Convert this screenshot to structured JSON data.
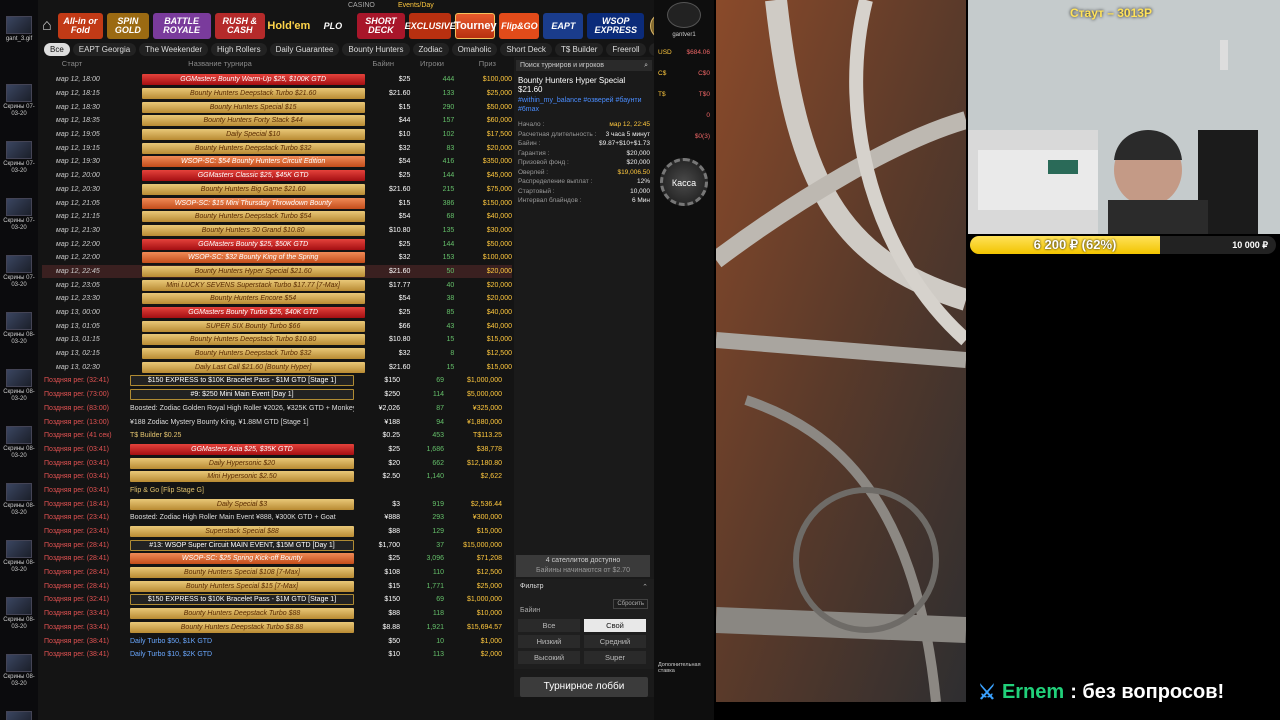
{
  "desktop": {
    "top_label": "gant_3.gif",
    "items": [
      "Скрины 07-03-20",
      "Скрины 07-03-20",
      "Скрины 07-03-20",
      "Скрины 07-03-20",
      "Скрины 08-03-20",
      "Скрины 08-03-20",
      "Скрины 08-03-20",
      "Скрины 08-03-20",
      "Скрины 08-03-20",
      "Скрины 08-03-20",
      "Скрины 08-03-20",
      "Скрины 08-03-20"
    ]
  },
  "nav": {
    "events_label": "Events/Day",
    "casino_label": "CASINO",
    "games": [
      "All-in or Fold",
      "SPIN GOLD",
      "BATTLE ROYALE",
      "RUSH & CASH",
      "Hold'em",
      "PLO",
      "SHORT DECK",
      "EXCLUSIVE",
      "Tourney",
      "Flip&GO",
      "EAPT",
      "WSOP EXPRESS"
    ]
  },
  "tabs": [
    "Все",
    "EAPT Georgia",
    "The Weekender",
    "High Rollers",
    "Daily Guarantee",
    "Bounty Hunters",
    "Zodiac",
    "Omaholic",
    "Short Deck",
    "T$ Builder",
    "Freeroll"
  ],
  "table_header": {
    "start": "Старт",
    "name": "Название турнира",
    "buyin": "Байин",
    "players": "Игроки",
    "prize": "Приз"
  },
  "rows": [
    {
      "start": "мар 12, 18:00",
      "name": "GGMasters Bounty Warm-Up $25, $100K GTD",
      "style": "red",
      "buyin": "$25",
      "players": "444",
      "prize": "$100,000"
    },
    {
      "start": "мар 12, 18:15",
      "name": "Bounty Hunters Deepstack Turbo $21.60",
      "style": "gold",
      "buyin": "$21.60",
      "players": "133",
      "prize": "$25,000"
    },
    {
      "start": "мар 12, 18:30",
      "name": "Bounty Hunters Special $15",
      "style": "gold",
      "buyin": "$15",
      "players": "290",
      "prize": "$50,000"
    },
    {
      "start": "мар 12, 18:35",
      "name": "Bounty Hunters Forty Stack $44",
      "style": "gold",
      "buyin": "$44",
      "players": "157",
      "prize": "$60,000"
    },
    {
      "start": "мар 12, 19:05",
      "name": "Daily Special $10",
      "style": "gold",
      "buyin": "$10",
      "players": "102",
      "prize": "$17,500"
    },
    {
      "start": "мар 12, 19:15",
      "name": "Bounty Hunters Deepstack Turbo $32",
      "style": "gold",
      "buyin": "$32",
      "players": "83",
      "prize": "$20,000"
    },
    {
      "start": "мар 12, 19:30",
      "name": "WSOP-SC: $54 Bounty Hunters Circuit Edition",
      "style": "orange",
      "buyin": "$54",
      "players": "416",
      "prize": "$350,000"
    },
    {
      "start": "мар 12, 20:00",
      "name": "GGMasters Classic $25, $45K GTD",
      "style": "red",
      "buyin": "$25",
      "players": "144",
      "prize": "$45,000"
    },
    {
      "start": "мар 12, 20:30",
      "name": "Bounty Hunters Big Game $21.60",
      "style": "gold",
      "buyin": "$21.60",
      "players": "215",
      "prize": "$75,000"
    },
    {
      "start": "мар 12, 21:05",
      "name": "WSOP-SC: $15 Mini Thursday Throwdown Bounty",
      "style": "orange",
      "buyin": "$15",
      "players": "386",
      "prize": "$150,000"
    },
    {
      "start": "мар 12, 21:15",
      "name": "Bounty Hunters Deepstack Turbo $54",
      "style": "gold",
      "buyin": "$54",
      "players": "68",
      "prize": "$40,000"
    },
    {
      "start": "мар 12, 21:30",
      "name": "Bounty Hunters 30 Grand $10.80",
      "style": "gold",
      "buyin": "$10.80",
      "players": "135",
      "prize": "$30,000"
    },
    {
      "start": "мар 12, 22:00",
      "name": "GGMasters Bounty $25, $50K GTD",
      "style": "red",
      "buyin": "$25",
      "players": "144",
      "prize": "$50,000"
    },
    {
      "start": "мар 12, 22:00",
      "name": "WSOP-SC: $32 Bounty King of the Spring",
      "style": "orange",
      "buyin": "$32",
      "players": "153",
      "prize": "$100,000"
    },
    {
      "start": "мар 12, 22:45",
      "name": "Bounty Hunters Hyper Special $21.60",
      "style": "gold",
      "buyin": "$21.60",
      "players": "50",
      "prize": "$20,000",
      "sel": true
    },
    {
      "start": "мар 12, 23:05",
      "name": "Mini LUCKY SEVENS Superstack Turbo $17.77 [7-Max]",
      "style": "gold",
      "buyin": "$17.77",
      "players": "40",
      "prize": "$20,000"
    },
    {
      "start": "мар 12, 23:30",
      "name": "Bounty Hunters Encore $54",
      "style": "gold",
      "buyin": "$54",
      "players": "38",
      "prize": "$20,000"
    },
    {
      "start": "мар 13, 00:00",
      "name": "GGMasters Bounty Turbo $25, $40K GTD",
      "style": "red",
      "buyin": "$25",
      "players": "85",
      "prize": "$40,000"
    },
    {
      "start": "мар 13, 01:05",
      "name": "SUPER SIX Bounty Turbo $66",
      "style": "gold",
      "buyin": "$66",
      "players": "43",
      "prize": "$40,000"
    },
    {
      "start": "мар 13, 01:15",
      "name": "Bounty Hunters Deepstack Turbo $10.80",
      "style": "gold",
      "buyin": "$10.80",
      "players": "15",
      "prize": "$15,000"
    },
    {
      "start": "мар 13, 02:15",
      "name": "Bounty Hunters Deepstack Turbo $32",
      "style": "gold",
      "buyin": "$32",
      "players": "8",
      "prize": "$12,500"
    },
    {
      "start": "мар 13, 02:30",
      "name": "Daily Last Call $21.60 [Bounty Hyper]",
      "style": "gold",
      "buyin": "$21.60",
      "players": "15",
      "prize": "$15,000"
    },
    {
      "late": "Поздняя рег. (32:41)",
      "name": "$150 EXPRESS to $10K Bracelet Pass - $1M GTD [Stage 1]",
      "style": "dark",
      "buyin": "$150",
      "players": "69",
      "prize": "$1,000,000"
    },
    {
      "late": "Поздняя рег. (73:00)",
      "name": "#9: $250 Mini Main Event [Day 1]",
      "style": "dark",
      "buyin": "$250",
      "players": "114",
      "prize": "$5,000,000"
    },
    {
      "late": "Поздняя рег. (83:00)",
      "name": "Boosted: Zodiac Golden Royal High Roller ¥2026, ¥325K GTD + Monkey",
      "style": "plain",
      "buyin": "¥2,026",
      "players": "87",
      "prize": "¥325,000"
    },
    {
      "late": "Поздняя рег. (13:00)",
      "name": "¥188 Zodiac Mystery Bounty King, ¥1.88M GTD [Stage 1]",
      "style": "plain",
      "buyin": "¥188",
      "players": "94",
      "prize": "¥1,880,000"
    },
    {
      "late": "Поздняя рег. (41 сек)",
      "name": "T$ Builder $0.25",
      "style": "plain gold",
      "buyin": "$0.25",
      "players": "453",
      "prize": "T$113.25"
    },
    {
      "late": "Поздняя рег. (03:41)",
      "name": "GGMasters Asia $25, $35K GTD",
      "style": "red",
      "buyin": "$25",
      "players": "1,686",
      "prize": "$38,778"
    },
    {
      "late": "Поздняя рег. (03:41)",
      "name": "Daily Hypersonic $20",
      "style": "gold",
      "buyin": "$20",
      "players": "662",
      "prize": "$12,180.80"
    },
    {
      "late": "Поздняя рег. (03:41)",
      "name": "Mini Hypersonic $2.50",
      "style": "gold",
      "buyin": "$2.50",
      "players": "1,140",
      "prize": "$2,622"
    },
    {
      "late": "Поздняя рег. (03:41)",
      "name": "Flip & Go [Flip Stage G]",
      "style": "plain gold",
      "buyin": "",
      "players": "",
      "prize": ""
    },
    {
      "late": "Поздняя рег. (18:41)",
      "name": "Daily Special $3",
      "style": "gold",
      "buyin": "$3",
      "players": "919",
      "prize": "$2,536.44"
    },
    {
      "late": "Поздняя рег. (23:41)",
      "name": "Boosted: Zodiac High Roller Main Event ¥888, ¥300K GTD + Goat",
      "style": "plain",
      "buyin": "¥888",
      "players": "293",
      "prize": "¥300,000"
    },
    {
      "late": "Поздняя рег. (23:41)",
      "name": "Superstack Special $88",
      "style": "gold",
      "buyin": "$88",
      "players": "129",
      "prize": "$15,000"
    },
    {
      "late": "Поздняя рег. (28:41)",
      "name": "#13: WSOP Super Circuit MAIN EVENT, $15M GTD [Day 1]",
      "style": "dark",
      "buyin": "$1,700",
      "players": "37",
      "prize": "$15,000,000"
    },
    {
      "late": "Поздняя рег. (28:41)",
      "name": "WSOP-SC: $25 Spring Kick-off Bounty",
      "style": "orange",
      "buyin": "$25",
      "players": "3,096",
      "prize": "$71,208"
    },
    {
      "late": "Поздняя рег. (28:41)",
      "name": "Bounty Hunters Special $108 [7-Max]",
      "style": "gold",
      "buyin": "$108",
      "players": "110",
      "prize": "$12,500"
    },
    {
      "late": "Поздняя рег. (28:41)",
      "name": "Bounty Hunters Special $15 [7-Max]",
      "style": "gold",
      "buyin": "$15",
      "players": "1,771",
      "prize": "$25,000"
    },
    {
      "late": "Поздняя рег. (32:41)",
      "name": "$150 EXPRESS to $10K Bracelet Pass - $1M GTD [Stage 1]",
      "style": "dark",
      "buyin": "$150",
      "players": "69",
      "prize": "$1,000,000"
    },
    {
      "late": "Поздняя рег. (33:41)",
      "name": "Bounty Hunters Deepstack Turbo $88",
      "style": "gold",
      "buyin": "$88",
      "players": "118",
      "prize": "$10,000"
    },
    {
      "late": "Поздняя рег. (33:41)",
      "name": "Bounty Hunters Deepstack Turbo $8.88",
      "style": "gold",
      "buyin": "$8.88",
      "players": "1,921",
      "prize": "$15,694.57"
    },
    {
      "late": "Поздняя рег. (38:41)",
      "name": "Daily Turbo $50, $1K GTD",
      "style": "plain blue",
      "buyin": "$50",
      "players": "10",
      "prize": "$1,000"
    },
    {
      "late": "Поздняя рег. (38:41)",
      "name": "Daily Turbo $10, $2K GTD",
      "style": "plain blue",
      "buyin": "$10",
      "players": "113",
      "prize": "$2,000"
    }
  ],
  "detail": {
    "search_placeholder": "Поиск турниров и игроков",
    "title": "Bounty Hunters Hyper Special $21.60",
    "tags": "#within_my_balance #озверей #баунти #6max",
    "fields": [
      {
        "k": "Начало :",
        "v": "мар 12, 22:45",
        "hi": true
      },
      {
        "k": "Расчетная длительность :",
        "v": "3 часа 5 минут"
      },
      {
        "k": "Байин :",
        "v": "$9.87+$10+$1.73"
      },
      {
        "k": "Гарантия :",
        "v": "$20,000"
      },
      {
        "k": "Призовой фонд :",
        "v": "$20,000"
      },
      {
        "k": "Оверлей :",
        "v": "$19,006.50",
        "hi": true
      },
      {
        "k": "Распределение выплат :",
        "v": "12%"
      },
      {
        "k": "Стартовый :",
        "v": "10,000"
      },
      {
        "k": "Интервал блайндов :",
        "v": "6 Мин"
      }
    ],
    "satellites": "4 сателлитов доступно",
    "satellites_sub": "Байины начинаются от $2.70",
    "filter_label": "Фильтр",
    "filter_reset": "Сбросить",
    "buyin_label": "Байин",
    "filter_buttons": [
      "Все",
      "Свой",
      "Низкий",
      "Средний",
      "Высокий",
      "Super"
    ],
    "lobby_button": "Турнирное лобби"
  },
  "wallet": {
    "username": "gantver1",
    "lines": [
      {
        "k": "USD",
        "v": "$684.06"
      },
      {
        "k": "C$",
        "v": "C$0"
      },
      {
        "k": "T$",
        "v": "T$0"
      },
      {
        "k": "",
        "v": "0"
      },
      {
        "k": "",
        "v": "$0(3)"
      }
    ],
    "kassa": "Касса",
    "extras_label": "Дополнительная ставка"
  },
  "stream": {
    "stat": "Стаут – 3013Р",
    "donation_text": "6 200 ₽ (62%)",
    "donation_goal": "10 000 ₽",
    "donation_fraction": 0.62,
    "chat_name": "Ernem",
    "chat_msg": ": без вопросов!"
  }
}
